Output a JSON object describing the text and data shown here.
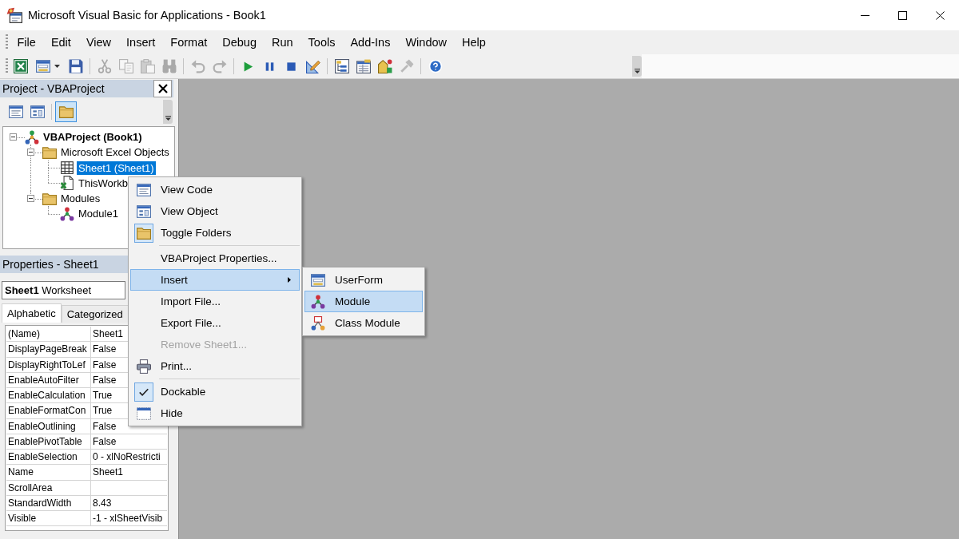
{
  "window": {
    "title": "Microsoft Visual Basic for Applications - Book1"
  },
  "menu_bar": {
    "items": [
      "File",
      "Edit",
      "View",
      "Insert",
      "Format",
      "Debug",
      "Run",
      "Tools",
      "Add-Ins",
      "Window",
      "Help"
    ]
  },
  "toolbar": {
    "groups": [
      [
        {
          "disabled": false
        },
        {
          "disabled": false
        },
        {
          "disabled": false
        }
      ],
      [
        {
          "disabled": true
        },
        {
          "disabled": true
        },
        {
          "disabled": true
        },
        {
          "disabled": true
        }
      ],
      [
        {
          "disabled": true
        },
        {
          "disabled": true
        }
      ],
      [
        {
          "disabled": false
        },
        {
          "disabled": false
        },
        {
          "disabled": false
        },
        {
          "disabled": false
        }
      ],
      [
        {
          "disabled": false
        },
        {
          "disabled": false
        },
        {
          "disabled": false
        },
        {
          "disabled": true
        }
      ],
      [
        {
          "disabled": false
        }
      ]
    ]
  },
  "project": {
    "title": "Project - VBAProject",
    "toolbar": {
      "groups": [
        [
          {
            "on": false
          },
          {
            "on": false
          }
        ],
        [
          {
            "on": true
          }
        ]
      ]
    },
    "tree": [
      {
        "label": "VBAProject (Book1)",
        "kind": "project",
        "expanded": true,
        "selected": false,
        "children": [
          {
            "label": "Microsoft Excel Objects",
            "kind": "folder",
            "expanded": true,
            "selected": false,
            "children": [
              {
                "label": "Sheet1 (Sheet1)",
                "kind": "sheet",
                "selected": true
              },
              {
                "label": "ThisWorkb",
                "kind": "workbook",
                "selected": false
              }
            ]
          },
          {
            "label": "Modules",
            "kind": "folder",
            "expanded": true,
            "selected": false,
            "children": [
              {
                "label": "Module1",
                "kind": "module",
                "selected": false
              }
            ]
          }
        ]
      }
    ]
  },
  "properties": {
    "title": "Properties - Sheet1",
    "object": "**Sheet1** Worksheet",
    "tabs": [
      {
        "label": "Alphabetic",
        "selected": true
      },
      {
        "label": "Categorized",
        "selected": false
      }
    ],
    "rows": [
      {
        "name": "(Name)",
        "value": "Sheet1"
      },
      {
        "name": "DisplayPageBreak",
        "value": "False"
      },
      {
        "name": "DisplayRightToLef",
        "value": "False"
      },
      {
        "name": "EnableAutoFilter",
        "value": "False"
      },
      {
        "name": "EnableCalculation",
        "value": "True"
      },
      {
        "name": "EnableFormatCon",
        "value": "True"
      },
      {
        "name": "EnableOutlining",
        "value": "False"
      },
      {
        "name": "EnablePivotTable",
        "value": "False"
      },
      {
        "name": "EnableSelection",
        "value": "0 - xlNoRestricti"
      },
      {
        "name": "Name",
        "value": "Sheet1"
      },
      {
        "name": "ScrollArea"
      },
      {
        "name": "StandardWidth",
        "value": "8.43"
      },
      {
        "name": "Visible",
        "value": "-1 - xlSheetVisib"
      }
    ]
  },
  "context_menu": {
    "items": [
      {
        "kind": "item",
        "label": "View Code",
        "selected": false,
        "checked": false,
        "disabled": false
      },
      {
        "kind": "item",
        "label": "View Object",
        "selected": false,
        "checked": false,
        "disabled": false
      },
      {
        "kind": "item",
        "label": "Toggle Folders",
        "selected": false,
        "checked": true,
        "disabled": false
      },
      {
        "kind": "separator"
      },
      {
        "kind": "item",
        "label": "VBAProject Properties...",
        "selected": false,
        "checked": false,
        "disabled": false
      },
      {
        "kind": "submenu",
        "label": "Insert",
        "selected": true,
        "checked": false,
        "disabled": false,
        "items": [
          {
            "label": "UserForm",
            "selected": false
          },
          {
            "label": "Module",
            "selected": true
          },
          {
            "label": "Class Module",
            "selected": false
          }
        ]
      },
      {
        "kind": "item",
        "label": "Import File...",
        "selected": false,
        "checked": false,
        "disabled": false
      },
      {
        "kind": "item",
        "label": "Export File...",
        "selected": false,
        "checked": false,
        "disabled": false
      },
      {
        "kind": "item",
        "label": "Remove Sheet1...",
        "selected": false,
        "checked": false,
        "disabled": true
      },
      {
        "kind": "item",
        "label": "Print...",
        "selected": false,
        "checked": false,
        "disabled": false
      },
      {
        "kind": "separator"
      },
      {
        "kind": "item",
        "label": "Dockable",
        "selected": false,
        "checked": true,
        "disabled": false
      },
      {
        "kind": "item",
        "label": "Hide",
        "selected": false,
        "checked": false,
        "disabled": false
      }
    ]
  }
}
